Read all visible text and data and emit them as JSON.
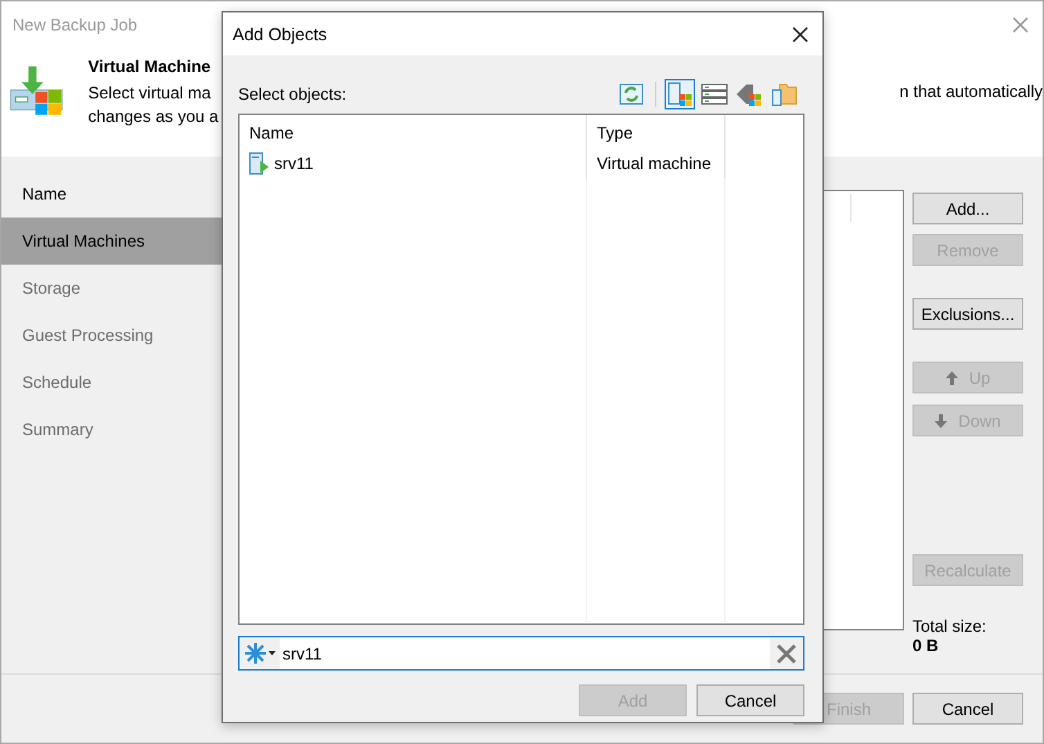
{
  "window": {
    "title": "New Backup Job"
  },
  "header": {
    "title": "Virtual Machine",
    "description_left": [
      "Select virtual ma",
      "changes as you a"
    ],
    "description_right": "n that automatically"
  },
  "steps": [
    {
      "label": "Name",
      "selected": false,
      "disabled": false
    },
    {
      "label": "Virtual Machines",
      "selected": true,
      "disabled": false
    },
    {
      "label": "Storage",
      "selected": false,
      "disabled": true
    },
    {
      "label": "Guest Processing",
      "selected": false,
      "disabled": true
    },
    {
      "label": "Schedule",
      "selected": false,
      "disabled": true
    },
    {
      "label": "Summary",
      "selected": false,
      "disabled": true
    }
  ],
  "side_buttons": [
    {
      "kind": "plain",
      "label": "Add...",
      "disabled": false
    },
    {
      "kind": "plain",
      "label": "Remove",
      "disabled": true
    },
    {
      "kind": "plain",
      "label": "Exclusions...",
      "disabled": false
    },
    {
      "kind": "up",
      "label": "Up",
      "disabled": true
    },
    {
      "kind": "down",
      "label": "Down",
      "disabled": true
    },
    {
      "kind": "plain",
      "label": "Recalculate",
      "disabled": true
    }
  ],
  "total_size": {
    "label": "Total size:",
    "value": "0 B"
  },
  "footer_buttons": [
    {
      "label": "Finish",
      "disabled": true
    },
    {
      "label": "Cancel",
      "disabled": false
    }
  ],
  "dialog": {
    "title": "Add Objects",
    "select_label": "Select objects:",
    "toolbar": [
      {
        "kind": "refresh",
        "selected": false
      },
      {
        "kind": "tree",
        "selected": true
      },
      {
        "kind": "list",
        "selected": false
      },
      {
        "kind": "tags",
        "selected": false
      },
      {
        "kind": "folders",
        "selected": false
      }
    ],
    "columns": [
      "Name",
      "Type"
    ],
    "rows": [
      {
        "name": "srv11",
        "type": "Virtual machine"
      }
    ],
    "search": {
      "value": "srv11"
    },
    "buttons": [
      {
        "label": "Add",
        "disabled": true
      },
      {
        "label": "Cancel",
        "disabled": false
      }
    ]
  }
}
